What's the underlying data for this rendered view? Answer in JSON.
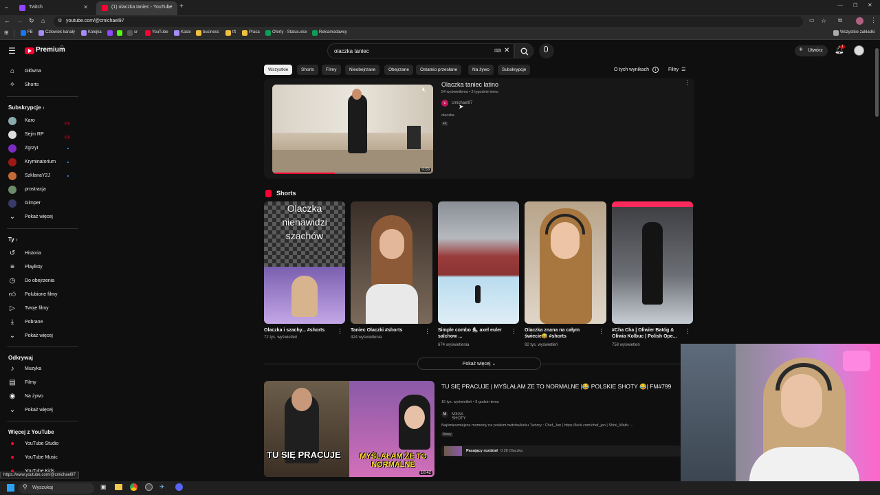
{
  "browser": {
    "tabs": [
      {
        "title": "Twitch"
      },
      {
        "title": "(1) olaczka taniec - YouTube"
      }
    ],
    "url": "youtube.com/@cmichael97",
    "bookmarks": [
      "FB",
      "Człowiek kanały",
      "Kolejka",
      "YouTube",
      "Kasix",
      "business",
      "tft",
      "Praca",
      "Oferty - Status.xlsx",
      "Reklamodawcy"
    ],
    "all_bookmarks": "Wszystkie zakładki",
    "status_url": "https://www.youtube.com/@cmichael97"
  },
  "youtube": {
    "logo": "Premium",
    "logo_sup": "PL",
    "search_value": "olaczka taniec",
    "create_label": "Utwórz",
    "notif_count": "1"
  },
  "sidebar": {
    "top": [
      {
        "label": "Główna",
        "icon": "home-icon"
      },
      {
        "label": "Shorts",
        "icon": "shorts-icon"
      }
    ],
    "subs_header": "Subskrypcje",
    "subs": [
      "Karo",
      "Sejm RP",
      "Zgrzyt",
      "Kryminatorium",
      "SzklanaY2J",
      "prostracja",
      "Gimper"
    ],
    "subs_more": "Pokaż więcej",
    "you_header": "Ty",
    "you": [
      "Historia",
      "Playlisty",
      "Do obejrzenia",
      "Polubione filmy",
      "Twoje filmy",
      "Pobrane"
    ],
    "you_more": "Pokaż więcej",
    "explore_header": "Odkrywaj",
    "explore": [
      "Muzyka",
      "Filmy",
      "Na żywo"
    ],
    "explore_more": "Pokaż więcej",
    "more_header": "Więcej z YouTube",
    "more": [
      "YouTube Studio",
      "YouTube Music",
      "YouTube Kids"
    ]
  },
  "chips": [
    "Wszystkie",
    "Shorts",
    "Filmy",
    "Nieobejrzane",
    "Obejrzane",
    "Ostatnio przesłane",
    "Na żywo",
    "Subskrypcje"
  ],
  "about_results": "O tych wynikach",
  "filters": "Filtry",
  "video1": {
    "title": "Olaczka taniec latino",
    "meta": "54 wyświetlenia • 2 tygodnie temu",
    "channel": "cmichael97",
    "desc": "olaczka",
    "badge": "4K",
    "duration": "0:53"
  },
  "shorts_header": "Shorts",
  "shorts": [
    {
      "title": "Olaczka i szachy... #shorts",
      "views": "72 tys. wyświetleń",
      "overlay": "Olaczka nienawidzi szachów"
    },
    {
      "title": "Taniec Olaczki #shorts",
      "views": "424 wyświetlenia"
    },
    {
      "title": "Simple combo ⛸️ axel euler salchow ...",
      "views": "674 wyświetlenia"
    },
    {
      "title": "Olaczka znana na całym świecie😅 #shorts",
      "views": "92 tys. wyświetleń"
    },
    {
      "title": "#Cha Cha | Oliwier Batóg & Oliwia Kolbuc | Polish Ope...",
      "views": "758 wyświetleń"
    }
  ],
  "show_more": "Pokaż więcej",
  "video2": {
    "title": "TU SIĘ PRACUJE | MYŚLAŁAM ŻE TO NORMALNE |😂 POLSKIE SHOTY 😂| FM#799",
    "meta": "16 tys. wyświetleń • 9 godzin temu",
    "channel": "M3GA SHOTY",
    "desc": "Najśmieszniejsze momenty na polskim twitchu/kicku Twórcy : Chef_Jan | https://kick.com/chef_jan | Shini_Waifu ...",
    "badge": "Nowy",
    "chapter_label": "Pasujący rozdział",
    "chapter_time": "0:28 Olaczka",
    "overlay_left": "TU SIĘ PRACUJE",
    "overlay_right": "MYŚLAŁAM ŻE TO NORMALNE",
    "duration": "10:42"
  },
  "taskbar": {
    "search": "Wyszukaj"
  }
}
